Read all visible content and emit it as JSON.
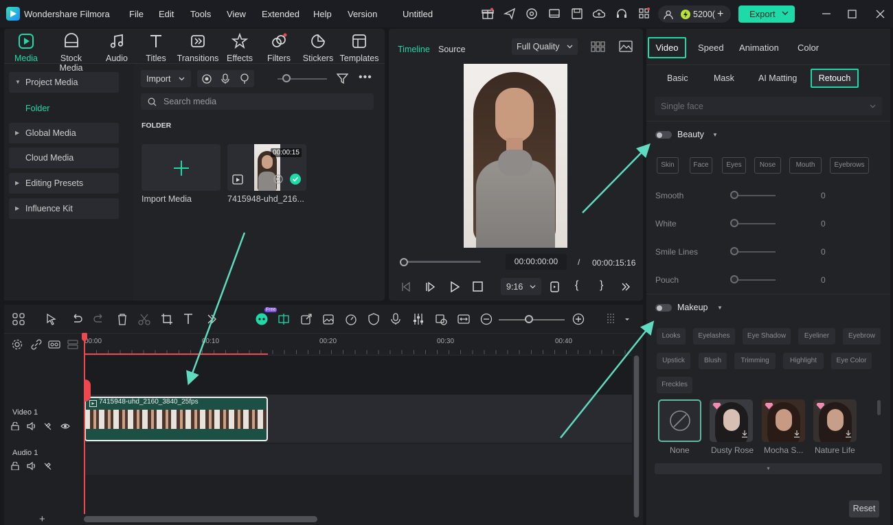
{
  "app": {
    "name": "Wondershare Filmora",
    "doc_title": "Untitled",
    "credits": "5200(",
    "export_label": "Export"
  },
  "menu": [
    "File",
    "Edit",
    "Tools",
    "View",
    "Extended",
    "Help",
    "Version"
  ],
  "toolbar": [
    {
      "label": "Media",
      "icon": "media-icon"
    },
    {
      "label": "Stock Media",
      "icon": "stock-media-icon"
    },
    {
      "label": "Audio",
      "icon": "audio-icon"
    },
    {
      "label": "Titles",
      "icon": "titles-icon"
    },
    {
      "label": "Transitions",
      "icon": "transitions-icon"
    },
    {
      "label": "Effects",
      "icon": "effects-icon"
    },
    {
      "label": "Filters",
      "icon": "filters-icon"
    },
    {
      "label": "Stickers",
      "icon": "stickers-icon"
    },
    {
      "label": "Templates",
      "icon": "templates-icon"
    }
  ],
  "sidebar": {
    "items": [
      {
        "label": "Project Media"
      },
      {
        "label": "Folder"
      },
      {
        "label": "Global Media"
      },
      {
        "label": "Cloud Media"
      },
      {
        "label": "Editing Presets"
      },
      {
        "label": "Influence Kit"
      }
    ]
  },
  "media": {
    "import_label": "Import",
    "search_placeholder": "Search media",
    "folder_heading": "FOLDER",
    "import_tile_label": "Import Media",
    "clip_name": "7415948-uhd_216...",
    "clip_duration": "00:00:15"
  },
  "player": {
    "tab_timeline": "Timeline",
    "tab_source": "Source",
    "quality": "Full Quality",
    "current_time": "00:00:00:00",
    "separator": "/",
    "total_time": "00:00:15:16",
    "ratio": "9:16",
    "progress": 0
  },
  "properties": {
    "tabs": [
      "Video",
      "Speed",
      "Animation",
      "Color"
    ],
    "subtabs": [
      "Basic",
      "Mask",
      "AI Matting",
      "Retouch"
    ],
    "face_mode": "Single face",
    "beauty": {
      "label": "Beauty",
      "chips": [
        "Skin",
        "Face",
        "Eyes",
        "Nose",
        "Mouth",
        "Eyebrows"
      ],
      "sliders": [
        {
          "label": "Smooth",
          "value": "0"
        },
        {
          "label": "White",
          "value": "0"
        },
        {
          "label": "Smile Lines",
          "value": "0"
        },
        {
          "label": "Pouch",
          "value": "0"
        }
      ]
    },
    "makeup": {
      "label": "Makeup",
      "chips": [
        "Looks",
        "Eyelashes",
        "Eye Shadow",
        "Eyeliner",
        "Eyebrow",
        "Upstick",
        "Blush",
        "Trimming",
        "Highlight",
        "Eye Color",
        "Freckles"
      ],
      "presets": [
        {
          "label": "None"
        },
        {
          "label": "Dusty Rose"
        },
        {
          "label": "Mocha S..."
        },
        {
          "label": "Nature Life"
        }
      ]
    },
    "reset_label": "Reset"
  },
  "timeline": {
    "ruler": [
      "00:00",
      "00:10",
      "00:20",
      "00:30",
      "00:40"
    ],
    "video_track": "Video 1",
    "audio_track": "Audio 1",
    "clip_label": "7415948-uhd_2160_3840_25fps",
    "free_badge": "Free"
  },
  "colors": {
    "accent": "#1ed9a8",
    "arrow": "#5fdcc0",
    "playhead": "#f0474f"
  }
}
